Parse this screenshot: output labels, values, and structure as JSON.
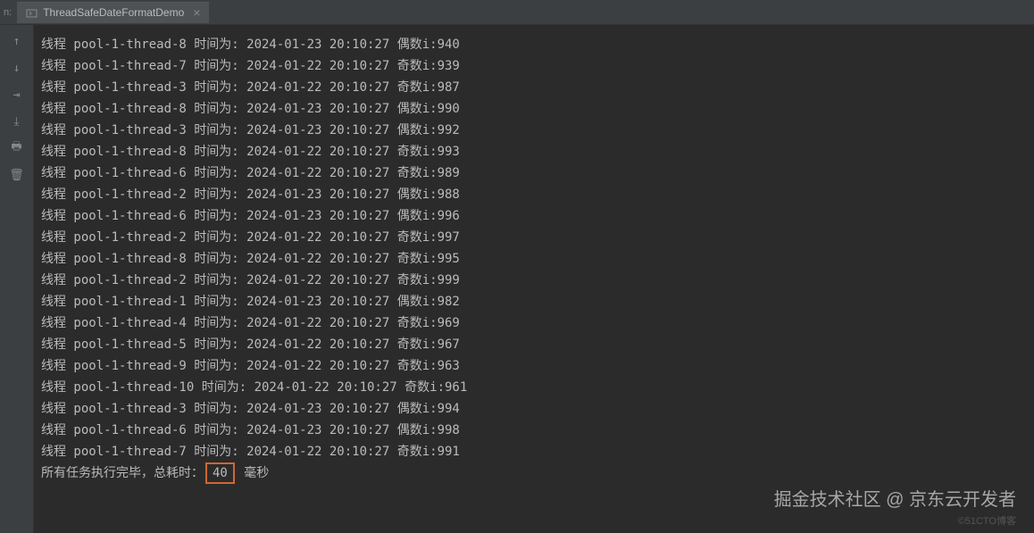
{
  "topbar": {
    "prefix_label": "n:",
    "tab_title": "ThreadSafeDateFormatDemo",
    "close_glyph": "×"
  },
  "gutter": {
    "icons": [
      {
        "name": "up-arrow-icon",
        "glyph": "↑"
      },
      {
        "name": "down-arrow-icon",
        "glyph": "↓"
      },
      {
        "name": "soft-wrap-icon",
        "glyph": "⇥"
      },
      {
        "name": "scroll-to-end-icon",
        "glyph": "⤓"
      },
      {
        "name": "print-icon",
        "glyph": "🖶"
      },
      {
        "name": "trash-icon",
        "glyph": "🗑"
      }
    ]
  },
  "console": {
    "lines": [
      {
        "thread": "pool-1-thread-8",
        "date": "2024-01-23 20:10:27",
        "type": "偶数",
        "i": 940
      },
      {
        "thread": "pool-1-thread-7",
        "date": "2024-01-22 20:10:27",
        "type": "奇数",
        "i": 939
      },
      {
        "thread": "pool-1-thread-3",
        "date": "2024-01-22 20:10:27",
        "type": "奇数",
        "i": 987
      },
      {
        "thread": "pool-1-thread-8",
        "date": "2024-01-23 20:10:27",
        "type": "偶数",
        "i": 990
      },
      {
        "thread": "pool-1-thread-3",
        "date": "2024-01-23 20:10:27",
        "type": "偶数",
        "i": 992
      },
      {
        "thread": "pool-1-thread-8",
        "date": "2024-01-22 20:10:27",
        "type": "奇数",
        "i": 993
      },
      {
        "thread": "pool-1-thread-6",
        "date": "2024-01-22 20:10:27",
        "type": "奇数",
        "i": 989
      },
      {
        "thread": "pool-1-thread-2",
        "date": "2024-01-23 20:10:27",
        "type": "偶数",
        "i": 988
      },
      {
        "thread": "pool-1-thread-6",
        "date": "2024-01-23 20:10:27",
        "type": "偶数",
        "i": 996
      },
      {
        "thread": "pool-1-thread-2",
        "date": "2024-01-22 20:10:27",
        "type": "奇数",
        "i": 997
      },
      {
        "thread": "pool-1-thread-8",
        "date": "2024-01-22 20:10:27",
        "type": "奇数",
        "i": 995
      },
      {
        "thread": "pool-1-thread-2",
        "date": "2024-01-22 20:10:27",
        "type": "奇数",
        "i": 999
      },
      {
        "thread": "pool-1-thread-1",
        "date": "2024-01-23 20:10:27",
        "type": "偶数",
        "i": 982
      },
      {
        "thread": "pool-1-thread-4",
        "date": "2024-01-22 20:10:27",
        "type": "奇数",
        "i": 969
      },
      {
        "thread": "pool-1-thread-5",
        "date": "2024-01-22 20:10:27",
        "type": "奇数",
        "i": 967
      },
      {
        "thread": "pool-1-thread-9",
        "date": "2024-01-22 20:10:27",
        "type": "奇数",
        "i": 963
      },
      {
        "thread": "pool-1-thread-10",
        "date": "2024-01-22 20:10:27",
        "type": "奇数",
        "i": 961
      },
      {
        "thread": "pool-1-thread-3",
        "date": "2024-01-23 20:10:27",
        "type": "偶数",
        "i": 994
      },
      {
        "thread": "pool-1-thread-6",
        "date": "2024-01-23 20:10:27",
        "type": "偶数",
        "i": 998
      },
      {
        "thread": "pool-1-thread-7",
        "date": "2024-01-22 20:10:27",
        "type": "奇数",
        "i": 991
      }
    ],
    "line_prefix": "线程 ",
    "time_label": " 时间为: ",
    "i_label": "i:",
    "summary_prefix": "所有任务执行完毕，总耗时：",
    "summary_value": "40",
    "summary_suffix": " 毫秒"
  },
  "watermark": {
    "main": "掘金技术社区 @ 京东云开发者",
    "sub": "©51CTO博客"
  }
}
